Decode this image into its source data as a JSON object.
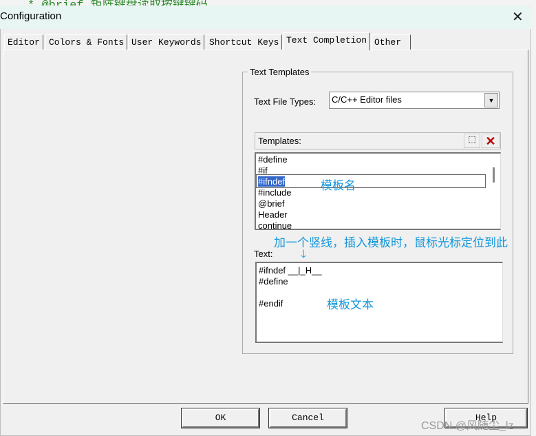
{
  "background_code": "* @brief  矩阵键盘读取按键键码",
  "window": {
    "title": "Configuration",
    "close_icon": "close-icon"
  },
  "tabs": [
    {
      "label": "Editor"
    },
    {
      "label": "Colors & Fonts"
    },
    {
      "label": "User Keywords"
    },
    {
      "label": "Shortcut Keys"
    },
    {
      "label": "Text Completion",
      "active": true
    },
    {
      "label": "Other"
    }
  ],
  "group": {
    "title": "Text Templates",
    "file_types_label": "Text File Types:",
    "file_types_value": "C/C++ Editor files",
    "templates_label": "Templates:",
    "templates": [
      "#define",
      "#if",
      "#ifndef",
      "#include",
      "@brief",
      "Header",
      "continue"
    ],
    "selected_template": "#ifndef",
    "text_label": "Text:",
    "text_lines": [
      "#ifndef __|_H__",
      "#define",
      "",
      "#endif"
    ]
  },
  "annotations": {
    "template_name": "模板名",
    "cursor_note": "加一个竖线，插入模板时，鼠标光标定位到此",
    "template_text": "模板文本"
  },
  "buttons": {
    "ok": "OK",
    "cancel": "Cancel",
    "help": "Help"
  },
  "watermark": "CSDN @风随尘_lz",
  "colors": {
    "annotation": "#1296db",
    "selection": "#3366cc",
    "title_bar": "#e8f6f3"
  }
}
